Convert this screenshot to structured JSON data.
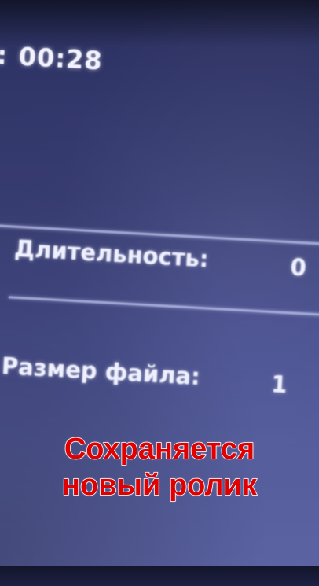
{
  "timer": {
    "prefix": ":",
    "value": "00:28"
  },
  "info": {
    "duration_label": "Длительность:",
    "duration_value": "0",
    "filesize_label": "Размер файла:",
    "filesize_value": "1"
  },
  "caption": {
    "line1": "Сохраняется",
    "line2": "новый ролик"
  },
  "colors": {
    "background": "#3a3f76",
    "text": "#eef0ff",
    "caption": "#e00000"
  }
}
